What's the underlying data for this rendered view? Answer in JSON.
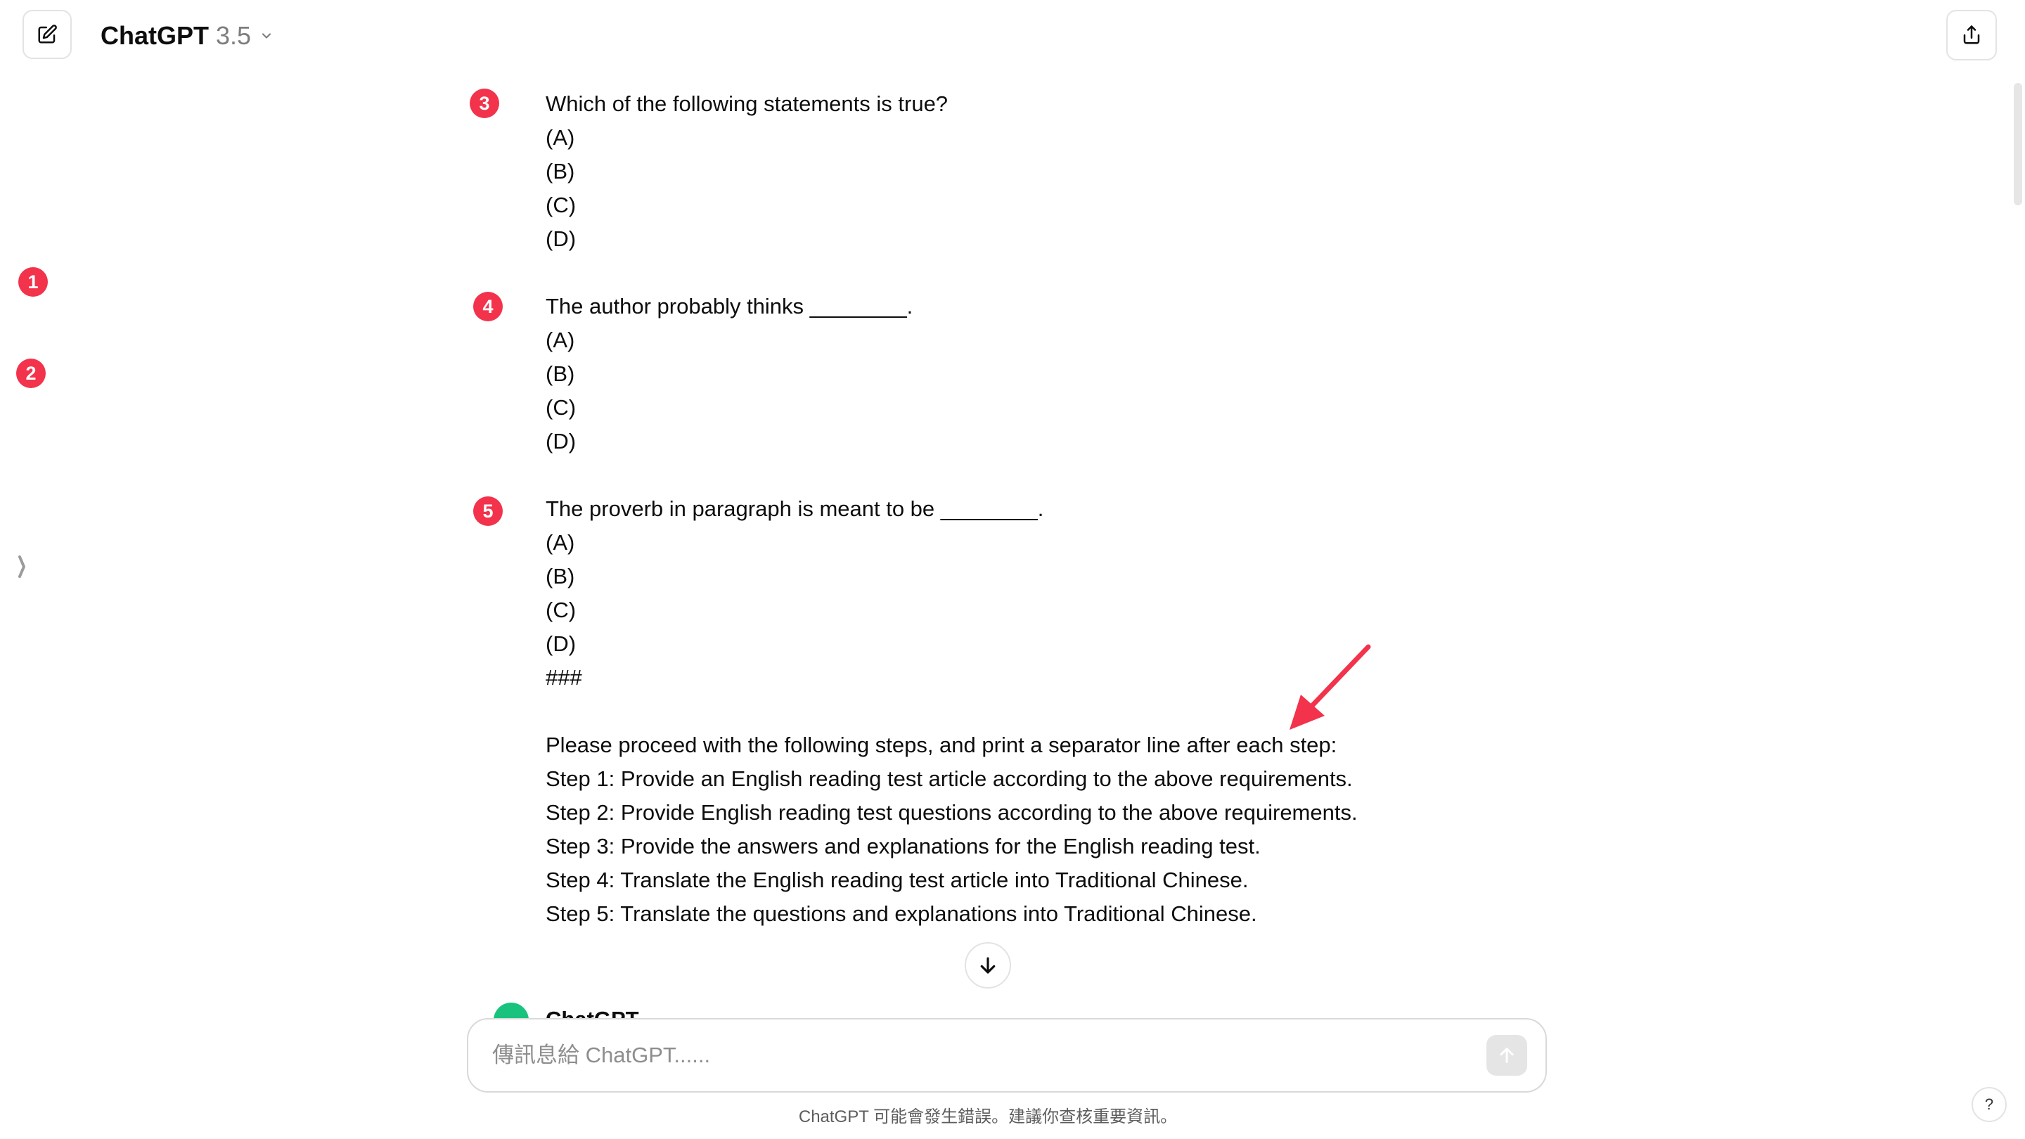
{
  "header": {
    "model_name": "ChatGPT",
    "model_version": "3.5"
  },
  "badges": [
    "1",
    "2",
    "3",
    "4",
    "5"
  ],
  "message": {
    "q3": {
      "stem": "Which of the following statements is true?",
      "options": [
        "(A)",
        "(B)",
        "(C)",
        "(D)"
      ]
    },
    "q4": {
      "stem": "The author probably thinks ________.",
      "options": [
        "(A)",
        "(B)",
        "(C)",
        "(D)"
      ]
    },
    "q5": {
      "stem": "The proverb in paragraph is meant to be ________.",
      "options": [
        "(A)",
        "(B)",
        "(C)",
        "(D)"
      ]
    },
    "separator": "###",
    "instructions": [
      "Please proceed with the following steps, and print a separator line after each step:",
      "Step 1: Provide an English reading test article according to the above requirements.",
      "Step 2: Provide English reading test questions according to the above requirements.",
      "Step 3: Provide the answers and explanations for the English reading test.",
      "Step 4: Translate the English reading test article into Traditional Chinese.",
      "Step 5: Translate the questions and explanations into Traditional Chinese."
    ]
  },
  "assistant": {
    "name": "ChatGPT"
  },
  "composer": {
    "placeholder": "傳訊息給 ChatGPT......",
    "value": ""
  },
  "footer": {
    "note": "ChatGPT 可能會發生錯誤。建議你查核重要資訊。"
  },
  "help": {
    "label": "?"
  },
  "colors": {
    "badge": "#f2334b",
    "arrow": "#f2334b",
    "avatar": "#19c37d"
  }
}
